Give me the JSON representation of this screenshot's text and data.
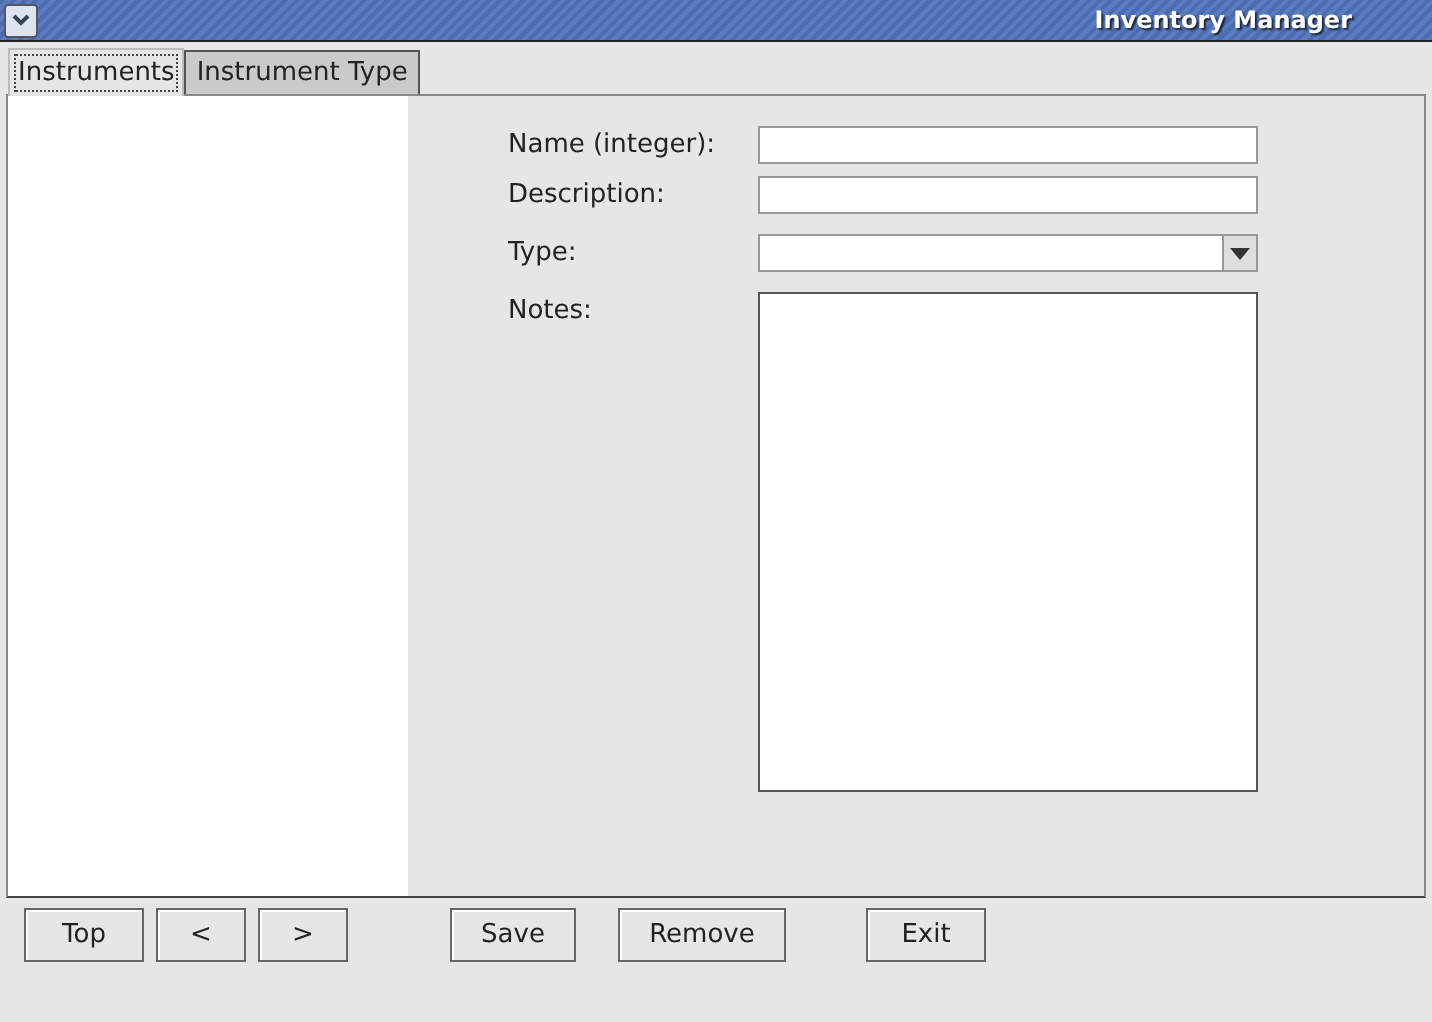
{
  "window": {
    "title": "Inventory Manager"
  },
  "tabs": [
    {
      "label": "Instruments",
      "selected": true
    },
    {
      "label": "Instrument Type",
      "selected": false
    }
  ],
  "form": {
    "fields": [
      {
        "label": "Name (integer):",
        "kind": "text"
      },
      {
        "label": "Description:",
        "kind": "text"
      },
      {
        "label": "Type:",
        "kind": "combo"
      },
      {
        "label": "Notes:",
        "kind": "textarea"
      }
    ]
  },
  "navigation_buttons": [
    "Top",
    "<",
    ">"
  ],
  "action_buttons": [
    "Save",
    "Remove",
    "Exit"
  ]
}
